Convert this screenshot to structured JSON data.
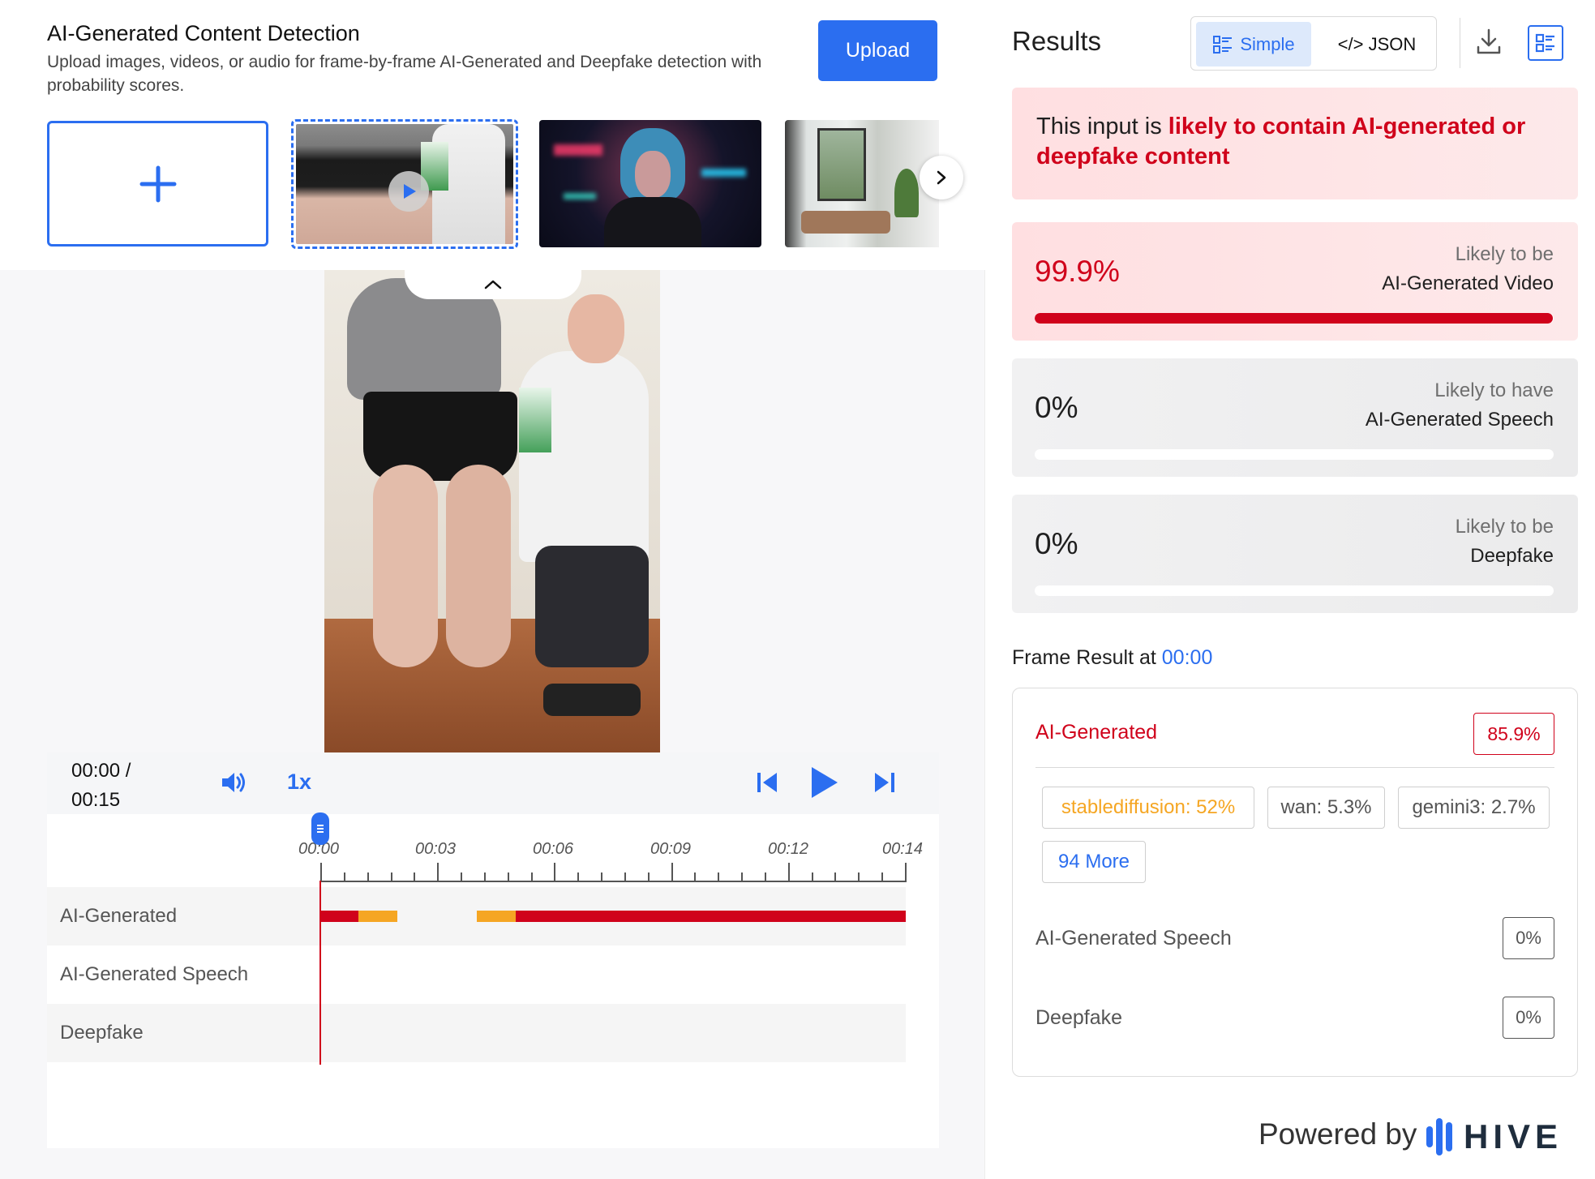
{
  "header": {
    "title": "AI-Generated Content Detection",
    "subtitle": "Upload images, videos, or audio for frame-by-frame AI-Generated and Deepfake detection with probability scores.",
    "upload_label": "Upload"
  },
  "thumbnails": [
    {
      "type": "add",
      "icon": "plus-icon"
    },
    {
      "type": "video",
      "selected": true,
      "icon": "play-icon"
    },
    {
      "type": "image"
    },
    {
      "type": "image"
    }
  ],
  "player": {
    "current_time": "00:00 /",
    "total_time": "00:15",
    "speed": "1x",
    "ruler_labels": [
      "00:00",
      "00:03",
      "00:06",
      "00:09",
      "00:12",
      "00:14"
    ],
    "tracks": [
      {
        "label": "AI-Generated"
      },
      {
        "label": "AI-Generated Speech"
      },
      {
        "label": "Deepfake"
      }
    ]
  },
  "results": {
    "title": "Results",
    "toggle": {
      "simple": "Simple",
      "json": "</> JSON"
    },
    "verdict_prefix": "This input is ",
    "verdict_highlight": "likely to contain AI-generated or deepfake content",
    "scores": [
      {
        "pct": "99.9%",
        "line1": "Likely to be",
        "line2": "AI-Generated Video",
        "fill": 0.999,
        "highlight": true
      },
      {
        "pct": "0%",
        "line1": "Likely to have",
        "line2": "AI-Generated Speech",
        "fill": 0,
        "highlight": false
      },
      {
        "pct": "0%",
        "line1": "Likely to be",
        "line2": "Deepfake",
        "fill": 0,
        "highlight": false
      }
    ],
    "frame_label": "Frame Result at ",
    "frame_time": "00:00",
    "frame": {
      "ai_label": "AI-Generated",
      "ai_pct": "85.9%",
      "chips": [
        "stablediffusion: 52%",
        "wan: 5.3%",
        "gemini3: 2.7%",
        "94 More"
      ],
      "speech_label": "AI-Generated Speech",
      "speech_pct": "0%",
      "deepfake_label": "Deepfake",
      "deepfake_pct": "0%"
    },
    "powered_by": "Powered by",
    "brand": "HIVE"
  },
  "colors": {
    "accent": "#2b6ef0",
    "danger": "#d0021b",
    "warning": "#f5a623"
  }
}
